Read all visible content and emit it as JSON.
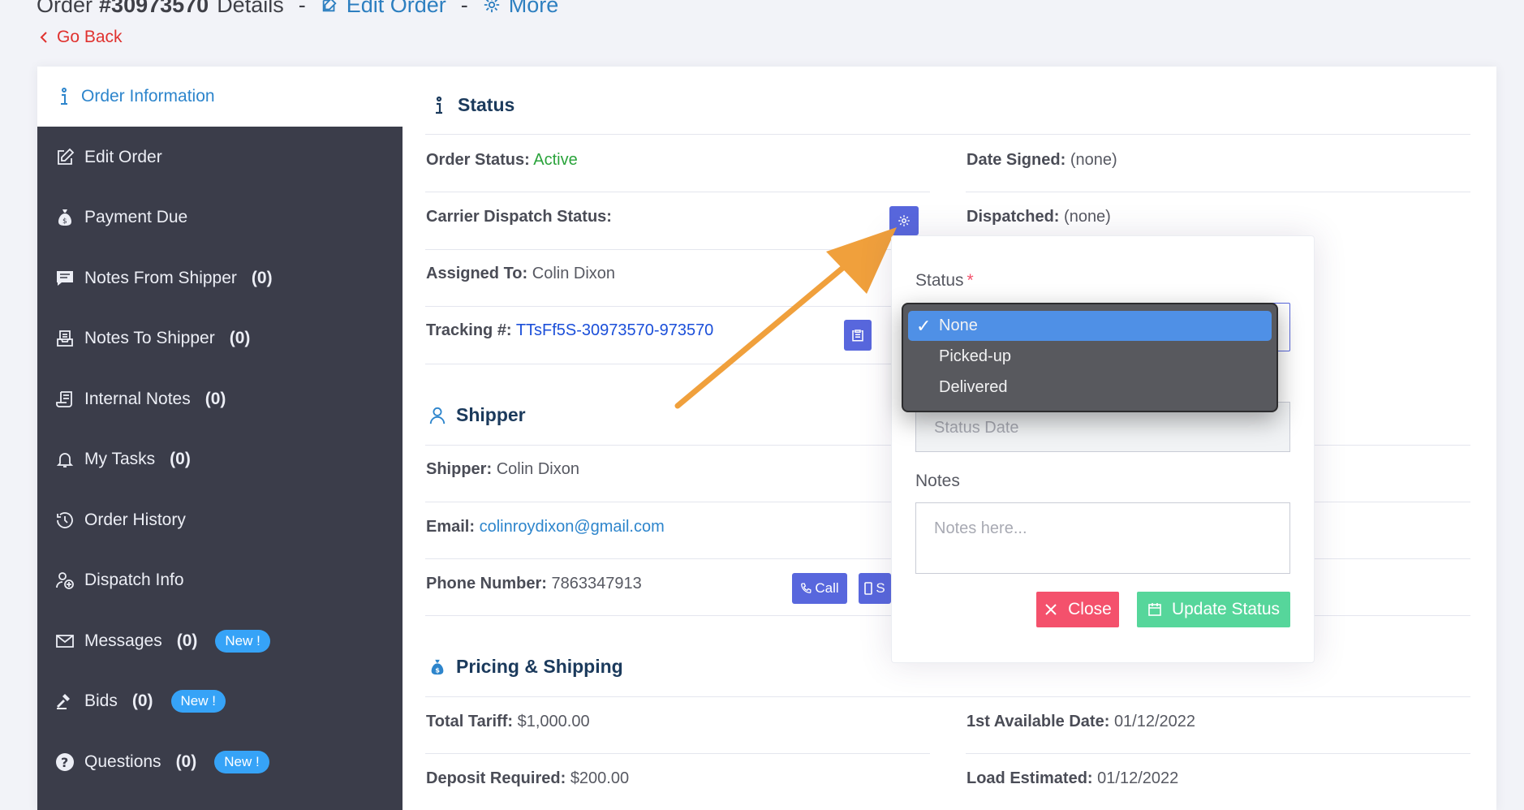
{
  "header": {
    "title_prefix": "Order",
    "order_number": "#30973570",
    "title_suffix": "Details",
    "separator": "-",
    "edit_order": "Edit Order",
    "more": "More",
    "go_back": "Go Back"
  },
  "sidebar": {
    "active": "Order Information",
    "items": [
      {
        "label": "Edit Order",
        "icon": "edit-icon",
        "count": "",
        "badge": ""
      },
      {
        "label": "Payment Due",
        "icon": "money-bag-icon",
        "count": "",
        "badge": ""
      },
      {
        "label": "Notes From Shipper",
        "icon": "comment-icon",
        "count": "(0)",
        "badge": ""
      },
      {
        "label": "Notes To Shipper",
        "icon": "inbox-icon",
        "count": "(0)",
        "badge": ""
      },
      {
        "label": "Internal Notes",
        "icon": "scroll-icon",
        "count": "(0)",
        "badge": ""
      },
      {
        "label": "My Tasks",
        "icon": "bell-icon",
        "count": "(0)",
        "badge": ""
      },
      {
        "label": "Order History",
        "icon": "history-icon",
        "count": "",
        "badge": ""
      },
      {
        "label": "Dispatch Info",
        "icon": "user-plus-icon",
        "count": "",
        "badge": ""
      },
      {
        "label": "Messages",
        "icon": "envelope-icon",
        "count": "(0)",
        "badge": "New !"
      },
      {
        "label": "Bids",
        "icon": "gavel-icon",
        "count": "(0)",
        "badge": "New !"
      },
      {
        "label": "Questions",
        "icon": "question-icon",
        "count": "(0)",
        "badge": "New !"
      }
    ]
  },
  "status": {
    "title": "Status",
    "order_status_label": "Order Status:",
    "order_status_value": "Active",
    "date_signed_label": "Date Signed:",
    "date_signed_value": "(none)",
    "carrier_dispatch_label": "Carrier Dispatch Status:",
    "dispatched_label": "Dispatched:",
    "dispatched_value": "(none)",
    "assigned_label": "Assigned To:",
    "assigned_value": "Colin Dixon",
    "tracking_label": "Tracking #:",
    "tracking_value": "TTsFf5S-30973570-973570"
  },
  "shipper": {
    "title": "Shipper",
    "shipper_label": "Shipper:",
    "shipper_value": "Colin Dixon",
    "email_label": "Email:",
    "email_value": "colinroydixon@gmail.com",
    "phone_label": "Phone Number:",
    "phone_value": "7863347913",
    "call_label": "Call",
    "sms_label": "S"
  },
  "pricing": {
    "title": "Pricing & Shipping",
    "tariff_label": "Total Tariff:",
    "tariff_value": "$1,000.00",
    "available_label": "1st Available Date:",
    "available_value": "01/12/2022",
    "deposit_label": "Deposit Required:",
    "deposit_value": "$200.00",
    "load_label": "Load Estimated:",
    "load_value": "01/12/2022"
  },
  "popover": {
    "status_label": "Status",
    "required_mark": "*",
    "status_date_placeholder": "Status Date",
    "notes_label": "Notes",
    "notes_placeholder": "Notes here...",
    "close_label": "Close",
    "update_label": "Update Status"
  },
  "dropdown": {
    "selected": "None",
    "options": [
      "None",
      "Picked-up",
      "Delivered"
    ],
    "check": "✓"
  },
  "colors": {
    "accent": "#5867dd",
    "sidebar_bg": "#3b3d4a",
    "active_link": "#2d85cc",
    "danger": "#f4516c",
    "success": "#56d69b",
    "annotation_arrow": "#f0a03c"
  }
}
